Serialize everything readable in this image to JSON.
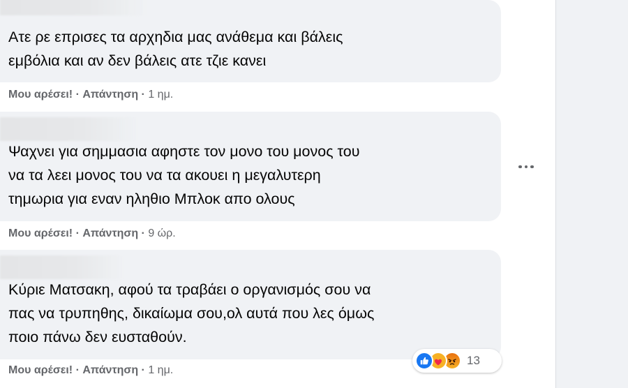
{
  "comments": [
    {
      "text": "Ατε ρε επρισες τα αρχηδια μας ανάθεμα και βάλεις\nεμβόλια και αν δεν βάλεις ατε τζιε κανει",
      "like_label": "Μου αρέσει!",
      "reply_label": "Απάντηση",
      "separator": "·",
      "time": "1 ημ."
    },
    {
      "text": "Ψαχνει για σημμασια αφηστε τον μονο του μονος του\nνα τα λεει μονος του να τα ακουει η μεγαλυτερη\nτημωρια για εναν ηληθιο Μπλοκ απο ολους",
      "like_label": "Μου αρέσει!",
      "reply_label": "Απάντηση",
      "separator": "·",
      "time": "9 ώρ."
    },
    {
      "text": "Κύριε Ματσακη, αφού τα τραβάει ο οργανισμός σου να\nπας να τρυπηθης, δικαίωμα σου,ολ αυτά που λες όμως\nποιο πάνω δεν ευσταθούν.",
      "like_label": "Μου αρέσει!",
      "reply_label": "Απάντηση",
      "separator": "·",
      "time": "1 ημ.",
      "reactions": {
        "icons": [
          "like-icon",
          "care-icon",
          "angry-icon"
        ],
        "count": "13"
      }
    }
  ],
  "colors": {
    "bubble": "#f0f2f5",
    "text": "#050505",
    "secondary_text": "#65676b",
    "like_blue": "#1877f2",
    "reaction_yellow": "#f7b125",
    "angry_orange": "#e9710f"
  },
  "more_menu": {
    "icon": "more-options-icon"
  }
}
